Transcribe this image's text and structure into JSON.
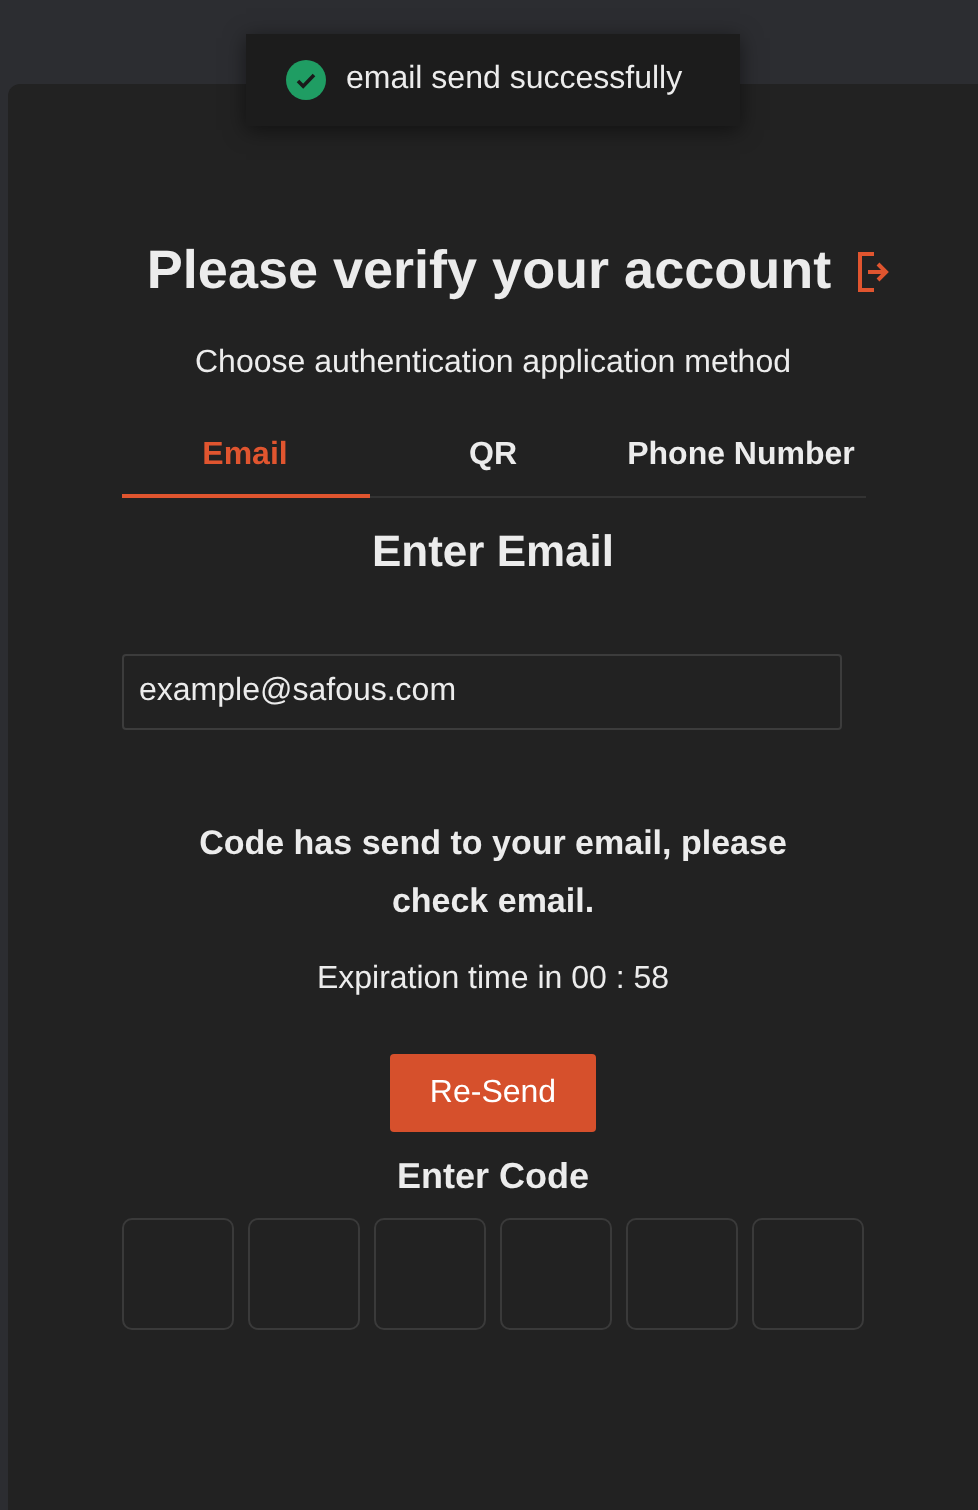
{
  "toast": {
    "success": true,
    "message": "email send successfully"
  },
  "title": "Please verify your account",
  "subtitle": "Choose authentication application method",
  "tabs": [
    {
      "label": "Email",
      "selected": true
    },
    {
      "label": "QR",
      "selected": false
    },
    {
      "label": "Phone Number",
      "selected": false
    }
  ],
  "email_section": {
    "heading": "Enter Email",
    "value": "example@safous.com"
  },
  "message": "Code has send to your email, please check email.",
  "expiration": "Expiration time in 00 : 58",
  "resend_button": "Re-Send",
  "code_section": {
    "heading": "Enter Code",
    "boxes": [
      {
        "filled": false
      },
      {
        "filled": false
      },
      {
        "filled": false
      },
      {
        "filled": false
      },
      {
        "filled": false
      },
      {
        "filled": false
      }
    ]
  }
}
